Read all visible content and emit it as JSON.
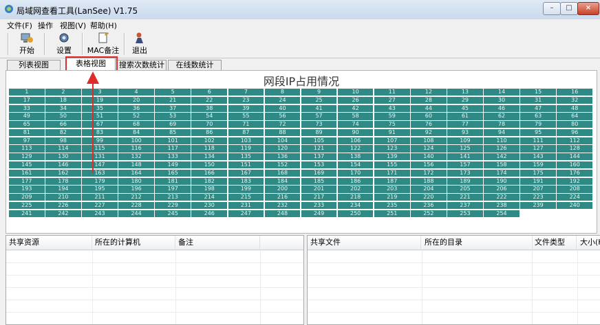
{
  "window": {
    "title": "局域网查看工具(LanSee) V1.75",
    "min": "–",
    "max": "□",
    "close": "×"
  },
  "menu": [
    "文件(F)",
    "操作",
    "视图(V)",
    "帮助(H)"
  ],
  "toolbar": [
    {
      "label": "开始",
      "icon": "start-icon"
    },
    {
      "label": "设置",
      "icon": "settings-icon"
    },
    {
      "label": "MAC备注",
      "icon": "mac-note-icon"
    },
    {
      "label": "退出",
      "icon": "exit-icon"
    }
  ],
  "tabs": [
    {
      "label": "列表视图",
      "active": false
    },
    {
      "label": "表格视图",
      "active": true
    },
    {
      "label": "搜索次数统计",
      "active": false
    },
    {
      "label": "在线数统计",
      "active": false
    }
  ],
  "grid": {
    "title": "网段IP占用情况",
    "start": 1,
    "end": 254,
    "cell_color": "#2f8a85"
  },
  "share_list": {
    "columns": [
      "共享资源",
      "所在的计算机",
      "备注"
    ]
  },
  "file_list": {
    "columns": [
      "共享文件",
      "所在的目录",
      "文件类型",
      "大小(K"
    ]
  },
  "colors": {
    "accent": "#2f8a85",
    "highlight": "#e02b2b"
  }
}
